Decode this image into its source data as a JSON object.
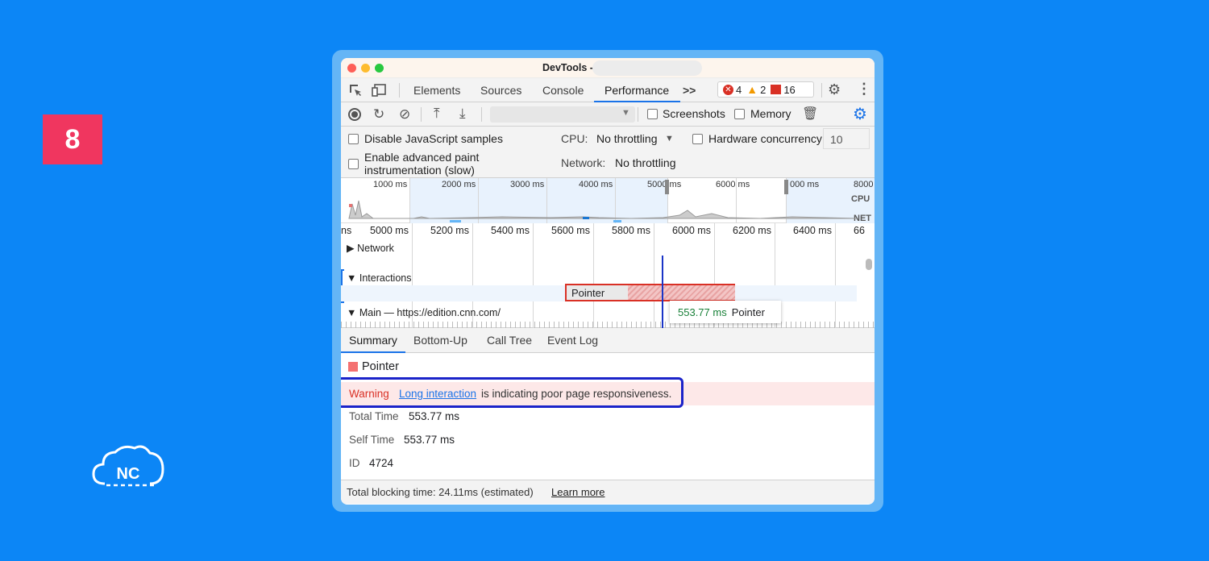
{
  "step_badge": "8",
  "logo_text": "NC",
  "window": {
    "title": "DevTools -",
    "tabs": [
      "Elements",
      "Sources",
      "Console",
      "Performance"
    ],
    "active_tab": "Performance",
    "more_tabs": ">>",
    "counters": {
      "errors": "4",
      "warnings": "2",
      "issues": "16"
    }
  },
  "toolbar": {
    "screenshots_label": "Screenshots",
    "memory_label": "Memory"
  },
  "settings": {
    "disable_js_samples": "Disable JavaScript samples",
    "advanced_paint_line1": "Enable advanced paint",
    "advanced_paint_line2": "instrumentation (slow)",
    "cpu_label": "CPU:",
    "cpu_value": "No throttling",
    "hw_concurrency_label": "Hardware concurrency",
    "hw_concurrency_value": "10",
    "network_label": "Network:",
    "network_value": "No throttling"
  },
  "overview": {
    "ticks": [
      "1000 ms",
      "2000 ms",
      "3000 ms",
      "4000 ms",
      "5000 ms",
      "6000 ms",
      "000 ms",
      "8000"
    ],
    "cpu_label": "CPU",
    "net_label": "NET"
  },
  "timeline": {
    "ruler": [
      "ns",
      "5000 ms",
      "5200 ms",
      "5400 ms",
      "5600 ms",
      "5800 ms",
      "6000 ms",
      "6200 ms",
      "6400 ms",
      "66"
    ],
    "tracks": {
      "network": "Network",
      "interactions": "Interactions",
      "main": "Main — https://edition.cnn.com/"
    },
    "pointer_event": "Pointer",
    "tooltip_duration": "553.77 ms",
    "tooltip_label": "Pointer"
  },
  "detail_tabs": [
    "Summary",
    "Bottom-Up",
    "Call Tree",
    "Event Log"
  ],
  "summary": {
    "event_title": "Pointer",
    "warning_label": "Warning",
    "warning_link": "Long interaction",
    "warning_text": "is indicating poor page responsiveness.",
    "total_time_label": "Total Time",
    "total_time_value": "553.77 ms",
    "self_time_label": "Self Time",
    "self_time_value": "553.77 ms",
    "id_label": "ID",
    "id_value": "4724"
  },
  "footer": {
    "text": "Total blocking time: 24.11ms (estimated)",
    "link": "Learn more"
  },
  "colors": {
    "background": "#0c86f6",
    "badge": "#f0365f",
    "warning": "#d93025",
    "highlight_outline": "#1b23c9",
    "link": "#1a73e8"
  }
}
